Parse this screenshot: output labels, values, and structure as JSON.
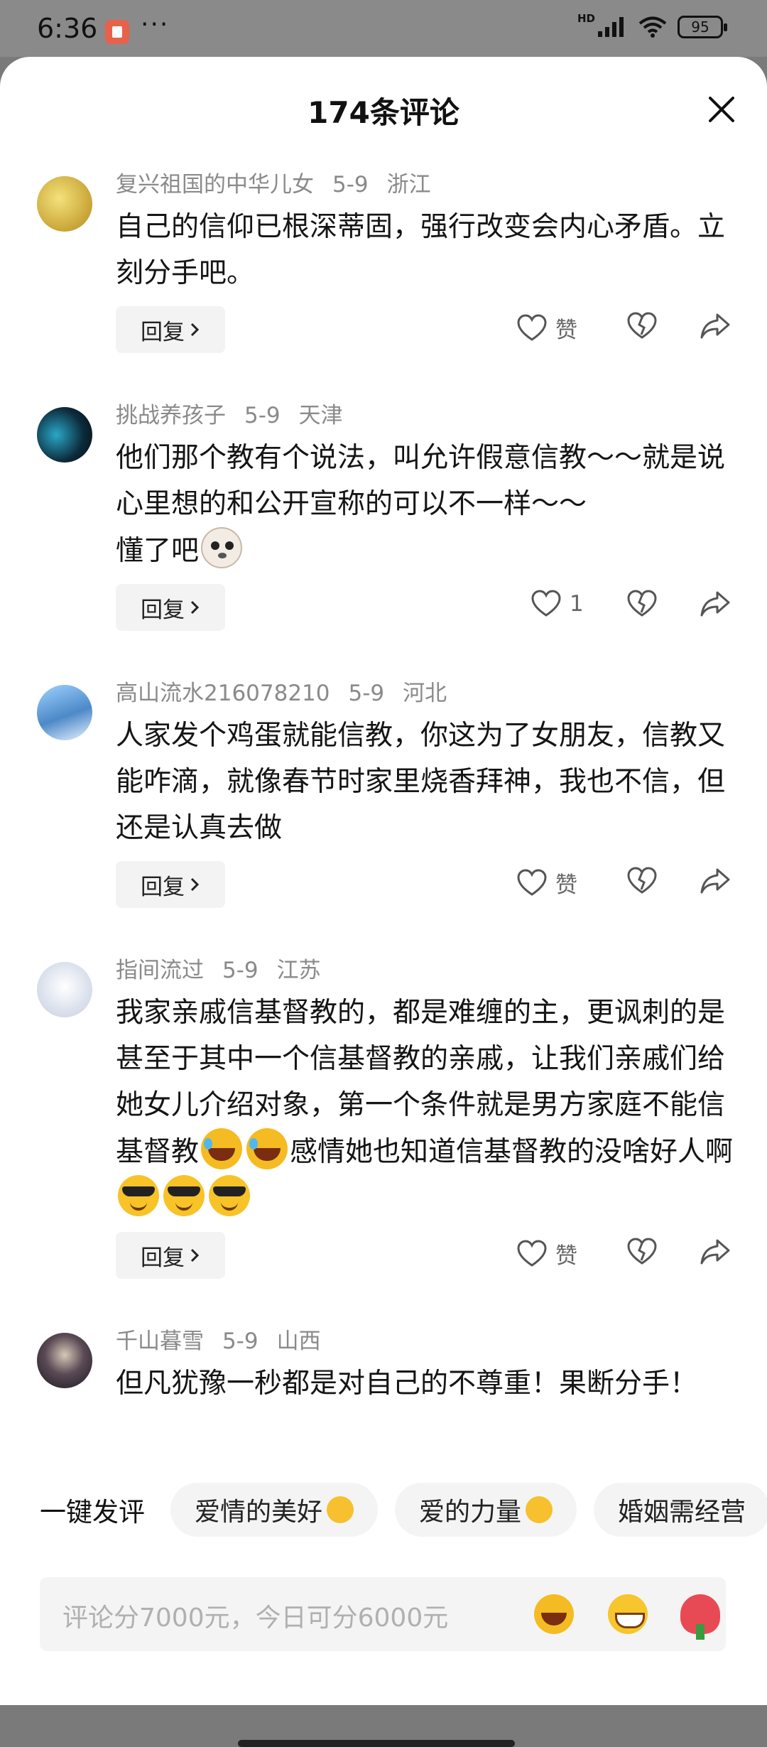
{
  "status_bar": {
    "time": "6:36",
    "dots": "···",
    "hd": "HD",
    "battery": "95"
  },
  "sheet": {
    "title": "174条评论"
  },
  "comments": [
    {
      "user": "复兴祖国的中华儿女",
      "date": "5-9",
      "location": "浙江",
      "text": "自己的信仰已根深蒂固，强行改变会内心矛盾。立刻分手吧。",
      "reply_label": "回复",
      "like_label": "赞",
      "avatar_color": "#d9c24b"
    },
    {
      "user": "挑战养孩子",
      "date": "5-9",
      "location": "天津",
      "text": "他们那个教有个说法，叫允许假意信教～～就是说心里想的和公开宣称的可以不一样～～",
      "text2": "懂了吧",
      "reply_label": "回复",
      "like_label": "1",
      "avatar_color": "#0c2a3a"
    },
    {
      "user": "高山流水216078210",
      "date": "5-9",
      "location": "河北",
      "text": "人家发个鸡蛋就能信教，你这为了女朋友，信教又能咋滴，就像春节时家里烧香拜神，我也不信，但还是认真去做",
      "reply_label": "回复",
      "like_label": "赞",
      "avatar_color": "#4c89c8"
    },
    {
      "user": "指间流过",
      "date": "5-9",
      "location": "江苏",
      "text_a": "我家亲戚信基督教的，都是难缠的主，更讽刺的是甚至于其中一个信基督教的亲戚，让我们亲戚们给她女儿介绍对象，第一个条件就是男方家庭不能信基督教",
      "text_b": "感情她也知道信基督教的没啥好人啊",
      "reply_label": "回复",
      "like_label": "赞",
      "avatar_color": "#dde3ee"
    },
    {
      "user": "千山暮雪",
      "date": "5-9",
      "location": "山西",
      "text": "但凡犹豫一秒都是对自己的不尊重！果断分手！",
      "avatar_color": "#3b3a45"
    }
  ],
  "quick_comments": {
    "label": "一键发评",
    "chips": [
      "爱情的美好",
      "爱的力量",
      "婚姻需经营"
    ]
  },
  "input": {
    "placeholder": "评论分7000元，今日可分6000元"
  },
  "colors": {
    "text": "#151515",
    "meta": "#8a8a8a",
    "chip_bg": "#f4f4f4"
  },
  "icons": [
    "close-icon",
    "heart-icon",
    "broken-heart-icon",
    "share-icon",
    "chevron-right-icon",
    "laugh-emoji-icon",
    "grin-emoji-icon",
    "rose-emoji-icon"
  ]
}
